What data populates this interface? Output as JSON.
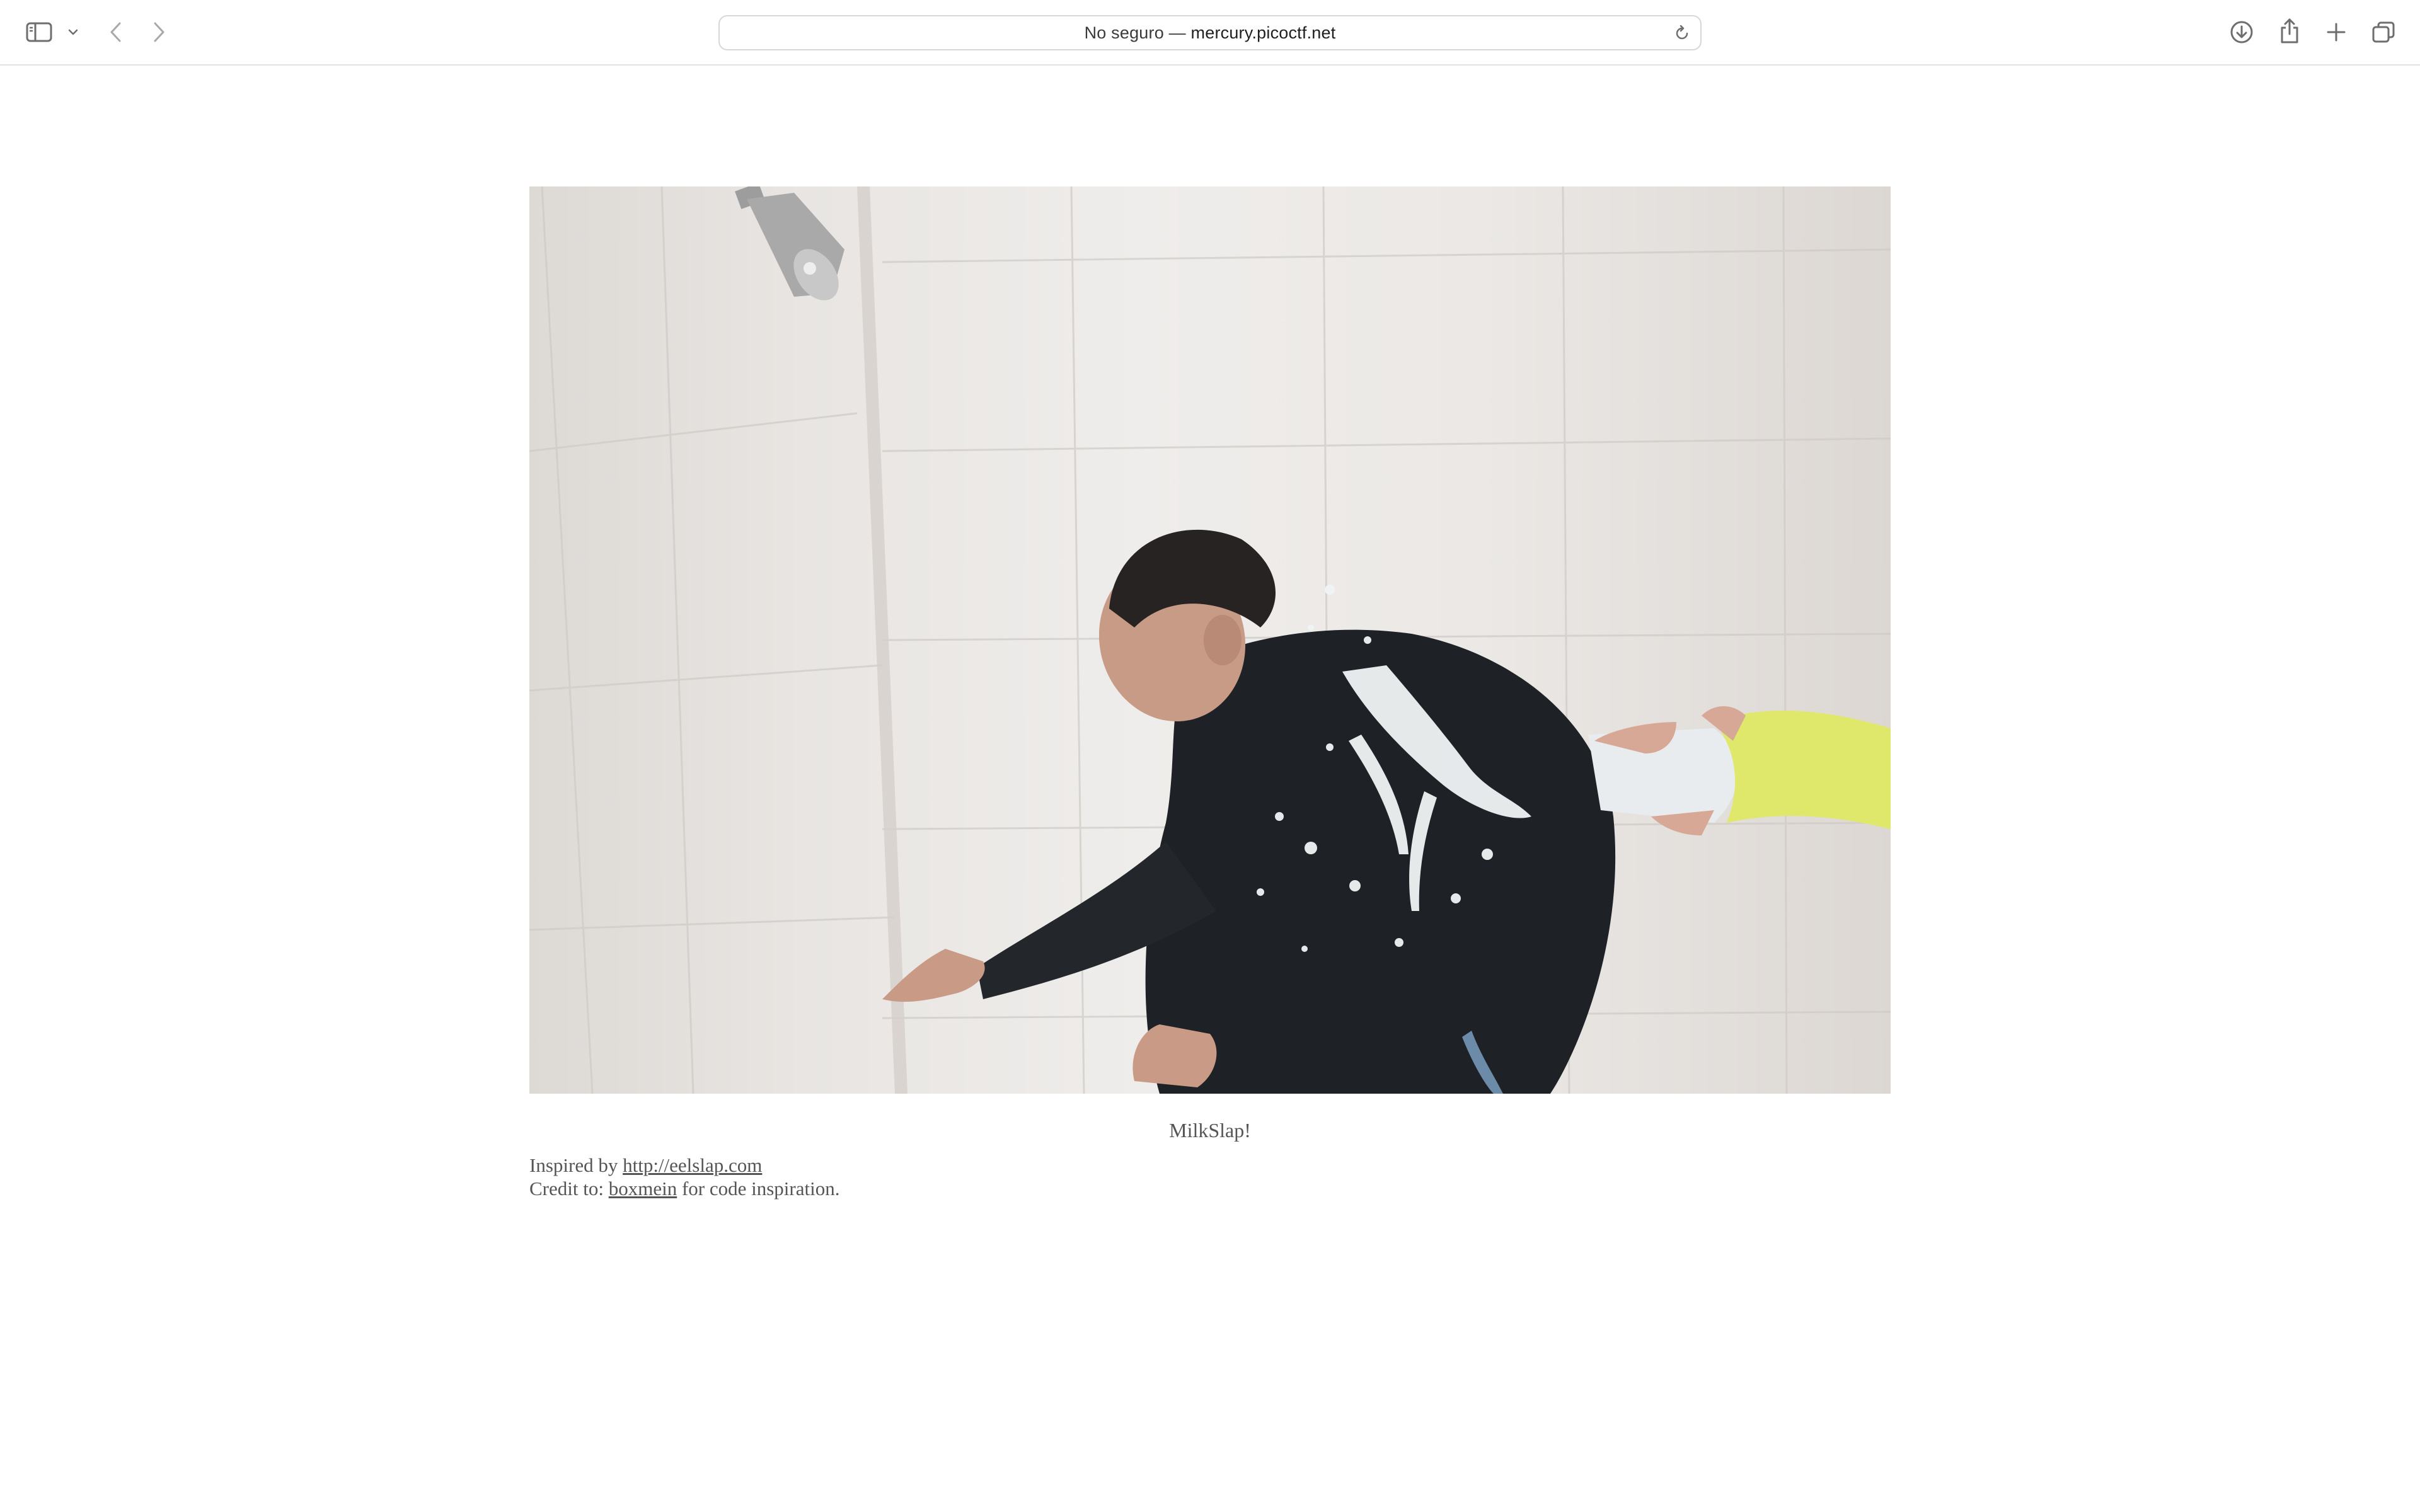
{
  "browser": {
    "address_prefix": "No seguro — ",
    "address_domain": "mercury.picoctf.net",
    "icons": [
      "sidebar-icon",
      "chevron-down-icon",
      "back-arrow-icon",
      "forward-arrow-icon",
      "reload-icon",
      "download-icon",
      "share-icon",
      "new-tab-icon",
      "tab-overview-icon"
    ]
  },
  "page": {
    "image_alt": "MilkSlap!",
    "caption": "MilkSlap!",
    "inspired_prefix": "Inspired by ",
    "inspired_link": "http://eelslap.com",
    "credit_prefix": "Credit to: ",
    "credit_link": "boxmein",
    "credit_suffix": " for code inspiration."
  },
  "colors": {
    "text": "#555555",
    "toolbar_border": "#e2e2e2",
    "sleeve": "#dfe86a"
  }
}
